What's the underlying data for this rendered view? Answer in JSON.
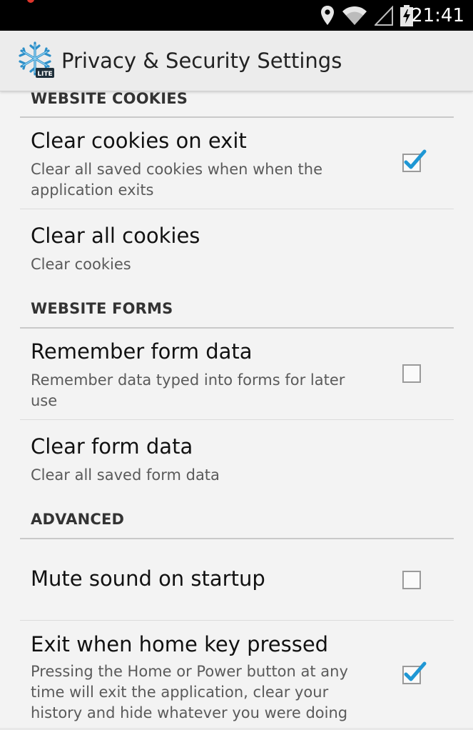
{
  "status_bar": {
    "time": "21:41",
    "icons": [
      "location-icon",
      "wifi-icon",
      "signal-icon",
      "battery-charging-icon"
    ],
    "notification_dot_color": "#e0352b"
  },
  "action_bar": {
    "title": "Privacy & Security Settings",
    "logo_icon": "snowflake-lite-logo",
    "logo_badge": "LITE"
  },
  "sections": [
    {
      "header": "WEBSITE COOKIES",
      "items": [
        {
          "title": "Clear cookies on exit",
          "summary": "Clear all saved cookies when when the application exits",
          "checkbox": true,
          "checked": true
        },
        {
          "title": "Clear all cookies",
          "summary": "Clear cookies",
          "checkbox": false
        }
      ]
    },
    {
      "header": "WEBSITE FORMS",
      "items": [
        {
          "title": "Remember form data",
          "summary": "Remember data typed into forms for later use",
          "checkbox": true,
          "checked": false
        },
        {
          "title": "Clear form data",
          "summary": "Clear all saved form data",
          "checkbox": false
        }
      ]
    },
    {
      "header": "ADVANCED",
      "items": [
        {
          "title": "Mute sound on startup",
          "summary": "",
          "checkbox": true,
          "checked": false
        },
        {
          "title": "Exit when home key pressed",
          "summary": "Pressing the Home or Power button at any time will exit the application, clear your history and hide whatever you were doing",
          "checkbox": true,
          "checked": true
        }
      ]
    }
  ],
  "colors": {
    "checkmark": "#1f97d4",
    "divider": "#c9c9c9"
  }
}
